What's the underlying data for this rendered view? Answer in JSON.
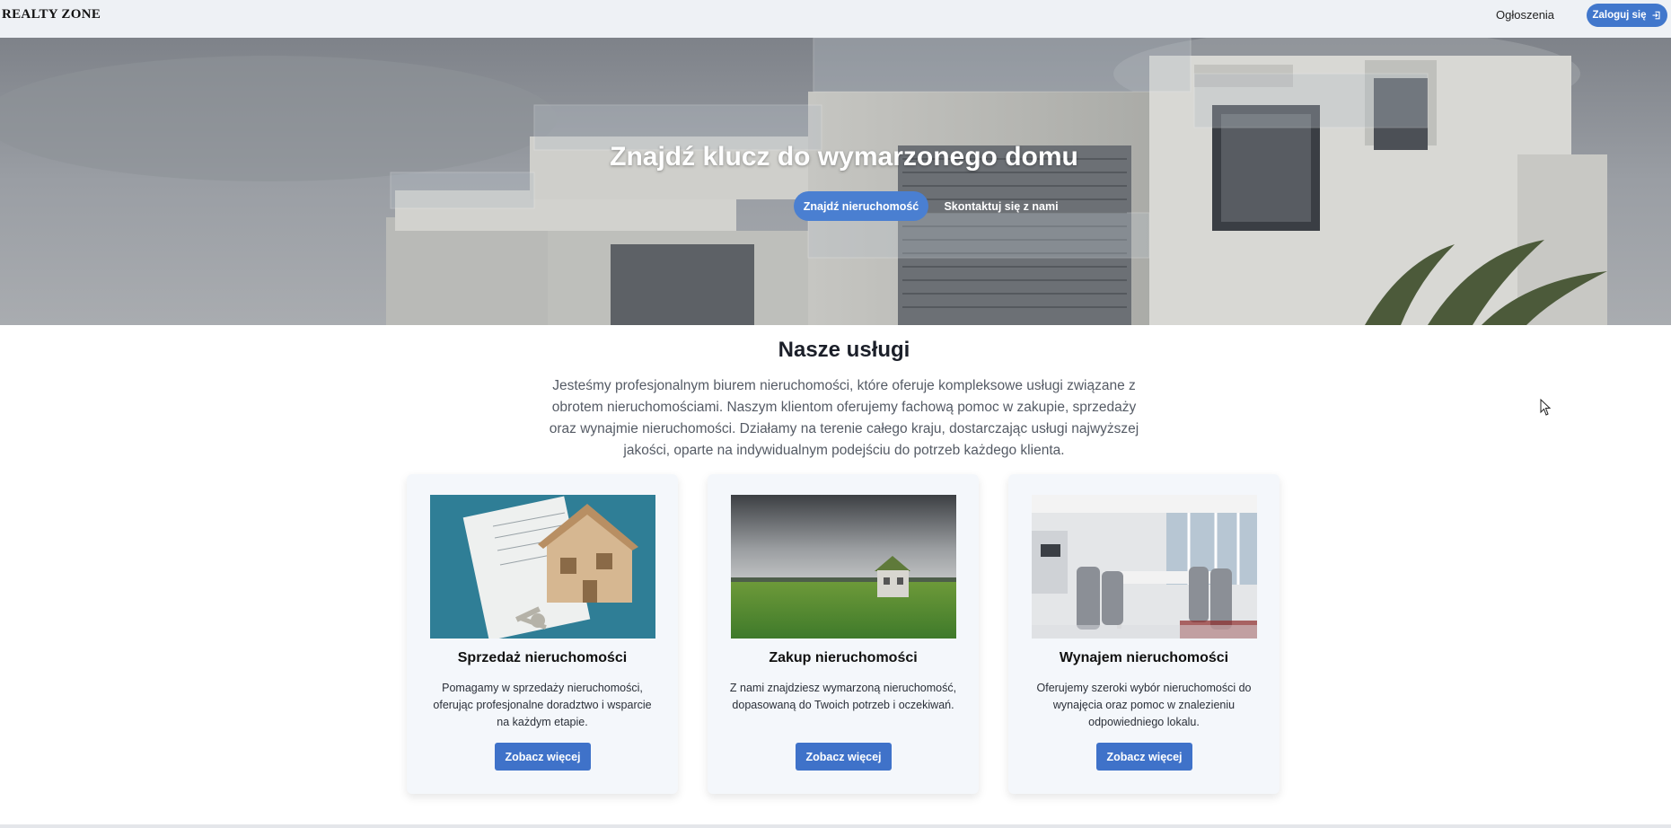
{
  "navbar": {
    "brand": "REALTY ZONE",
    "link_listings": "Ogłoszenia",
    "login_label": "Zaloguj się",
    "login_icon": "sign-in-icon"
  },
  "hero": {
    "title": "Znajdź klucz do wymarzonego domu",
    "primary_button": "Znajdź nieruchomość",
    "secondary_button": "Skontaktuj się z nami"
  },
  "services": {
    "title": "Nasze usługi",
    "description": "Jesteśmy profesjonalnym biurem nieruchomości, które oferuje kompleksowe usługi związane z obrotem nieruchomościami. Naszym klientom oferujemy fachową pomoc w zakupie, sprzedaży oraz wynajmie nieruchomości. Działamy na terenie całego kraju, dostarczając usługi najwyższej jakości, oparte na indywidualnym podejściu do potrzeb każdego klienta.",
    "cards": [
      {
        "title": "Sprzedaż nieruchomości",
        "text": "Pomagamy w sprzedaży nieruchomości, oferując profesjonalne doradztwo i wsparcie na każdym etapie.",
        "button": "Zobacz więcej"
      },
      {
        "title": "Zakup nieruchomości",
        "text": "Z nami znajdziesz wymarzoną nieruchomość, dopasowaną do Twoich potrzeb i oczekiwań.",
        "button": "Zobacz więcej"
      },
      {
        "title": "Wynajem nieruchomości",
        "text": "Oferujemy szeroki wybór nieruchomości do wynajęcia oraz pomoc w znalezieniu odpowiedniego lokalu.",
        "button": "Zobacz więcej"
      }
    ]
  },
  "colors": {
    "accent": "#4177cc",
    "navbar_bg": "#eef1f5",
    "card_bg": "#f4f7fb"
  }
}
